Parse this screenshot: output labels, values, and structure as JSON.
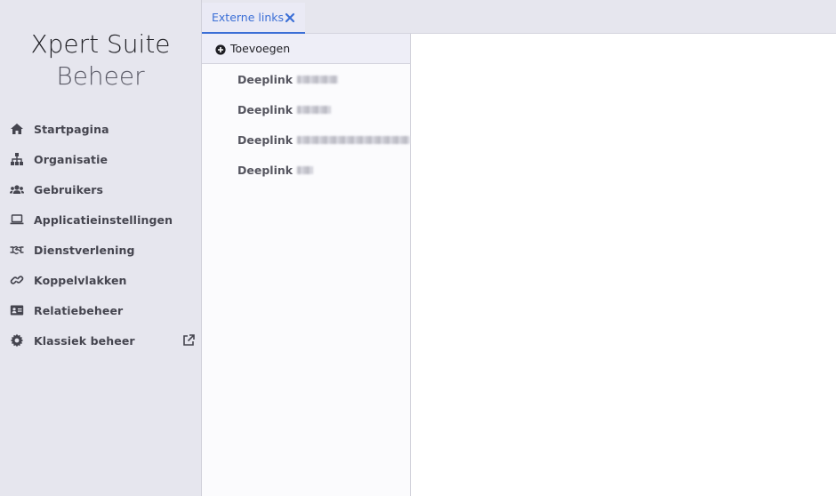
{
  "brand": {
    "line1": "Xpert Suite",
    "line2": "Beheer"
  },
  "sidebar": {
    "items": [
      {
        "label": "Startpagina",
        "icon": "home-icon"
      },
      {
        "label": "Organisatie",
        "icon": "sitemap-icon"
      },
      {
        "label": "Gebruikers",
        "icon": "users-icon"
      },
      {
        "label": "Applicatieinstellingen",
        "icon": "laptop-icon"
      },
      {
        "label": "Dienstverlening",
        "icon": "handshake-icon"
      },
      {
        "label": "Koppelvlakken",
        "icon": "link-icon"
      },
      {
        "label": "Relatiebeheer",
        "icon": "address-card-icon"
      },
      {
        "label": "Klassiek beheer",
        "icon": "gear-icon",
        "external": true
      }
    ]
  },
  "tabs": [
    {
      "label": "Externe links",
      "active": true
    }
  ],
  "list": {
    "add_label": "Toevoegen",
    "items": [
      {
        "label": "Deeplink",
        "redacted": true
      },
      {
        "label": "Deeplink",
        "redacted": true
      },
      {
        "label": "Deeplink",
        "redacted": true
      },
      {
        "label": "Deeplink",
        "redacted": true
      }
    ]
  },
  "colors": {
    "accent": "#3b6fd6",
    "sidebar_bg": "#e6e6ee",
    "text": "#45454f"
  }
}
